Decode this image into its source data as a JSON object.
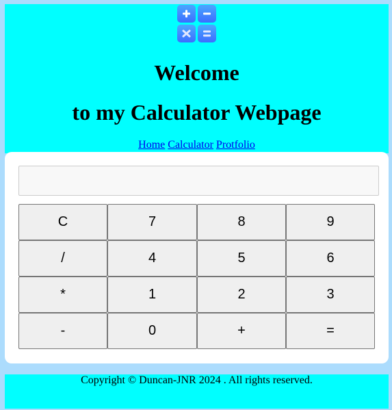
{
  "header": {
    "welcome_line1": "Welcome",
    "welcome_line2": "to my Calculator Webpage",
    "nav": [
      {
        "label": "Home"
      },
      {
        "label": "Calculator"
      },
      {
        "label": "Protfolio"
      }
    ]
  },
  "calculator": {
    "display_value": "",
    "buttons": [
      "C",
      "7",
      "8",
      "9",
      "/",
      "4",
      "5",
      "6",
      "*",
      "1",
      "2",
      "3",
      "-",
      "0",
      "+",
      "="
    ]
  },
  "footer": {
    "copyright": "Copyright © Duncan-JNR 2024 . All rights reserved."
  },
  "colors": {
    "page_background": "#acdcfd",
    "header_background": "#00ffff",
    "logo_tile": "#3d6dff",
    "button_background": "#efefef"
  },
  "icons": [
    "plus-icon",
    "minus-icon",
    "times-icon",
    "equals-icon"
  ]
}
